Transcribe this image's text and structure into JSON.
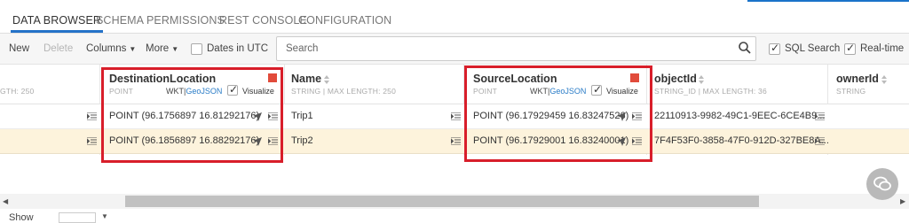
{
  "tabs": [
    "DATA BROWSER",
    "SCHEMA",
    "PERMISSIONS",
    "REST CONSOLE",
    "CONFIGURATION"
  ],
  "toolbar": {
    "new_label": "New",
    "delete_label": "Delete",
    "columns_label": "Columns",
    "more_label": "More",
    "dates_utc_label": "Dates in UTC",
    "search_placeholder": "Search",
    "sql_search_label": "SQL Search",
    "realtime_label": "Real-time"
  },
  "columns": {
    "prev_meta": "GTH: 250",
    "dest": {
      "name": "DestinationLocation",
      "meta": "POINT",
      "wkt": "WKT",
      "sep": "|",
      "geojson": "GeoJSON",
      "visualize": "Visualize"
    },
    "name": {
      "name": "Name",
      "meta": "STRING | MAX LENGTH: 250"
    },
    "source": {
      "name": "SourceLocation",
      "meta": "POINT",
      "wkt": "WKT",
      "sep": "|",
      "geojson": "GeoJSON",
      "visualize": "Visualize"
    },
    "objectid": {
      "name": "objectId",
      "meta": "STRING_ID | MAX LENGTH: 36"
    },
    "ownerid": {
      "name": "ownerId",
      "meta": "STRING"
    }
  },
  "rows": [
    {
      "dest": "POINT (96.1756897 16.81292176)",
      "name": "Trip1",
      "source": "POINT (96.17929459 16.83247526)",
      "objectid": "22110913-9982-49C1-9EEC-6CE4B9..."
    },
    {
      "dest": "POINT (96.1856897 16.88292176)",
      "name": "Trip2",
      "source": "POINT (96.17929001 16.83240001)",
      "objectid": "7F4F53F0-3858-47F0-912D-327BE8A..."
    }
  ],
  "footer": {
    "label": "Show"
  },
  "colors": {
    "accent": "#2472c8",
    "highlight_row": "#fdf3dc",
    "red_marker": "#e14b3b",
    "red_box": "#d81e2a",
    "link": "#2a7cc7"
  },
  "icons": [
    "search-icon",
    "edit-icon",
    "navigate-arrow-icon",
    "sort-icon",
    "chat-icon",
    "scroll-left-icon",
    "scroll-right-icon"
  ]
}
